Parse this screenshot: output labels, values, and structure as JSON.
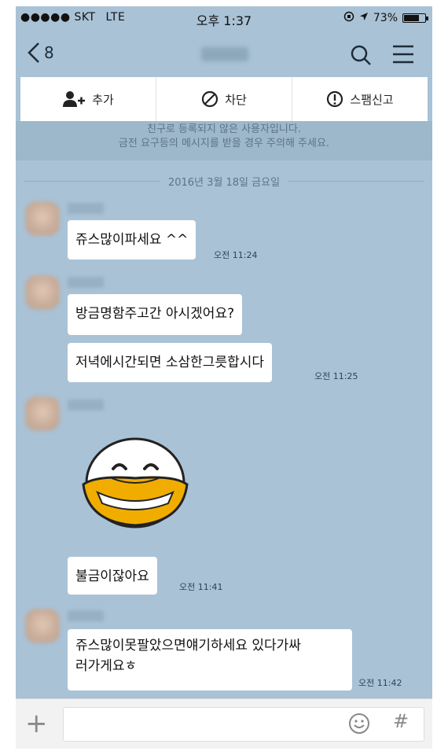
{
  "status_bar": {
    "carrier": "●●●●● SKT",
    "network": "LTE",
    "time": "오후 1:37",
    "battery": "73%",
    "battery_level": 0.73
  },
  "nav": {
    "back_count": "8"
  },
  "actions": [
    {
      "label": "추가",
      "icon": "add-friend-icon"
    },
    {
      "label": "차단",
      "icon": "block-icon"
    },
    {
      "label": "스팸신고",
      "icon": "report-icon"
    }
  ],
  "notice": {
    "line1": "친구로 등록되지 않은 사용자입니다.",
    "line2": "금전 요구등의 메시지를 받을 경우 주의해 주세요."
  },
  "date_divider": "2016년 3월 18일 금요일",
  "messages": [
    {
      "text": "쥬스많이파세요 ^^",
      "time": "오전 11:24"
    },
    {
      "text": "방금명함주고간 아시겠어요?",
      "time": ""
    },
    {
      "text": "저녁에시간되면 소삼한그릇합시다",
      "time": "오전 11:25"
    },
    {
      "text": "불금이잖아요",
      "time": "오전 11:41"
    },
    {
      "text_line1": "쥬스많이못팔았으면얘기하세요 있다가싸",
      "text_line2": "러가게요ㅎ",
      "time": "오전 11:42"
    }
  ],
  "colors": {
    "chat_background": "#a9c2d6",
    "bubble": "#ffffff",
    "emoticon_beak": "#f0ad00"
  }
}
